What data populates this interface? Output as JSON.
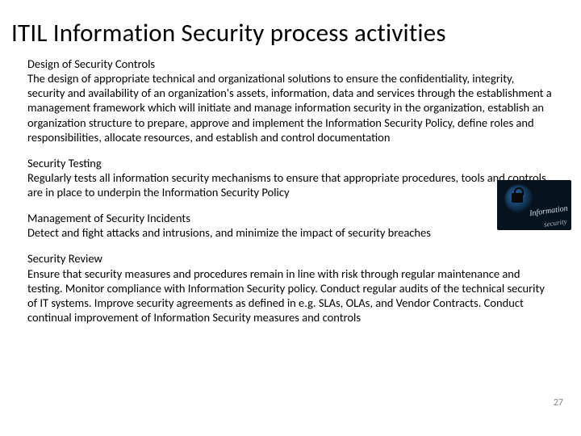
{
  "title": "ITIL Information Security process activities",
  "sections": [
    {
      "heading": "Design of Security Controls",
      "body": "The design of appropriate technical and organizational solutions to ensure the confidentiality, integrity, security and availability of an organization's assets, information, data and services through the establishment a management framework which will initiate and manage information security in the organization, establish an organization structure to prepare, approve and implement the Information Security Policy, define roles and responsibilities, allocate resources, and establish and control documentation"
    },
    {
      "heading": "Security Testing",
      "body": "Regularly tests all information security mechanisms to ensure that appropriate procedures, tools and controls are in place to underpin the Information Security Policy"
    },
    {
      "heading": "Management of Security Incidents",
      "body": "Detect and fight attacks and intrusions, and minimize the impact of security breaches"
    },
    {
      "heading": "Security Review",
      "body": "Ensure that security measures and procedures remain in line with risk through regular maintenance and testing. Monitor compliance with Information Security policy. Conduct regular audits of the technical security of IT systems. Improve security agreements as defined in e.g. SLAs, OLAs, and Vendor Contracts. Conduct continual improvement of Information Security measures and controls"
    }
  ],
  "thumbnail": {
    "label_top": "Information",
    "label_bottom": "security"
  },
  "page_number": "27"
}
